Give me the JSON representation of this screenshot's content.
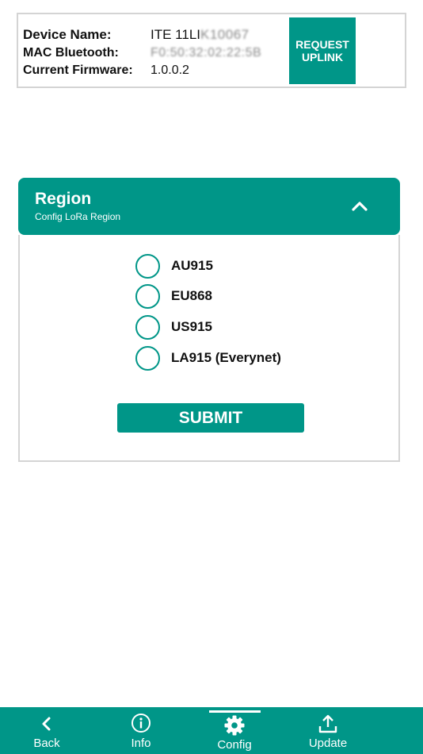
{
  "device": {
    "name_label": "Device Name:",
    "name_value": "ITE 11LI",
    "name_redacted": "K10067",
    "mac_label": "MAC Bluetooth:",
    "mac_redacted": "F0:50:32:02:22:5B",
    "firmware_label": "Current Firmware:",
    "firmware_value": "1.0.0.2",
    "request_button": "REQUEST\nUPLINK"
  },
  "region": {
    "title": "Region",
    "subtitle": "Config LoRa Region",
    "options": [
      "AU915",
      "EU868",
      "US915",
      "LA915 (Everynet)"
    ],
    "selected": null,
    "submit_label": "SUBMIT"
  },
  "nav": {
    "items": [
      {
        "label": "Back",
        "icon": "chevron-left-icon"
      },
      {
        "label": "Info",
        "icon": "info-icon"
      },
      {
        "label": "Config",
        "icon": "gear-icon"
      },
      {
        "label": "Update",
        "icon": "upload-icon"
      }
    ],
    "active": "Config"
  },
  "colors": {
    "accent": "#009688",
    "border": "#d4d4d4"
  }
}
